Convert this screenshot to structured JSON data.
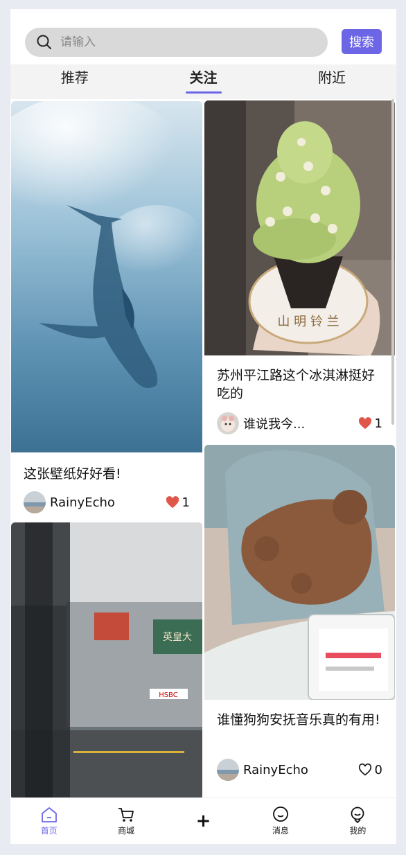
{
  "search": {
    "placeholder": "请输入",
    "button_label": "搜索"
  },
  "tabs": [
    {
      "label": "推荐",
      "active": false
    },
    {
      "label": "关注",
      "active": true
    },
    {
      "label": "附近",
      "active": false
    }
  ],
  "posts": [
    {
      "title": "这张壁纸好好看!",
      "author": "RainyEcho",
      "likes": "1",
      "liked": true,
      "image": "whale-wallpaper"
    },
    {
      "title": "苏州平江路这个冰淇淋挺好吃的",
      "author": "谁说我今...",
      "likes": "1",
      "liked": true,
      "image": "matcha-ice-cream"
    },
    {
      "title": "谁懂狗狗安抚音乐真的有用!",
      "author": "RainyEcho",
      "likes": "0",
      "liked": false,
      "image": "sleeping-poodle"
    },
    {
      "image": "street-scene"
    }
  ],
  "bottom_nav": [
    {
      "label": "首页",
      "icon": "home-icon",
      "active": true
    },
    {
      "label": "商城",
      "icon": "cart-icon",
      "active": false
    },
    {
      "label": "+",
      "icon": "plus-icon",
      "active": false
    },
    {
      "label": "消息",
      "icon": "message-icon",
      "active": false
    },
    {
      "label": "我的",
      "icon": "profile-icon",
      "active": false
    }
  ],
  "colors": {
    "accent": "#6c66e6",
    "like": "#e0574a"
  }
}
